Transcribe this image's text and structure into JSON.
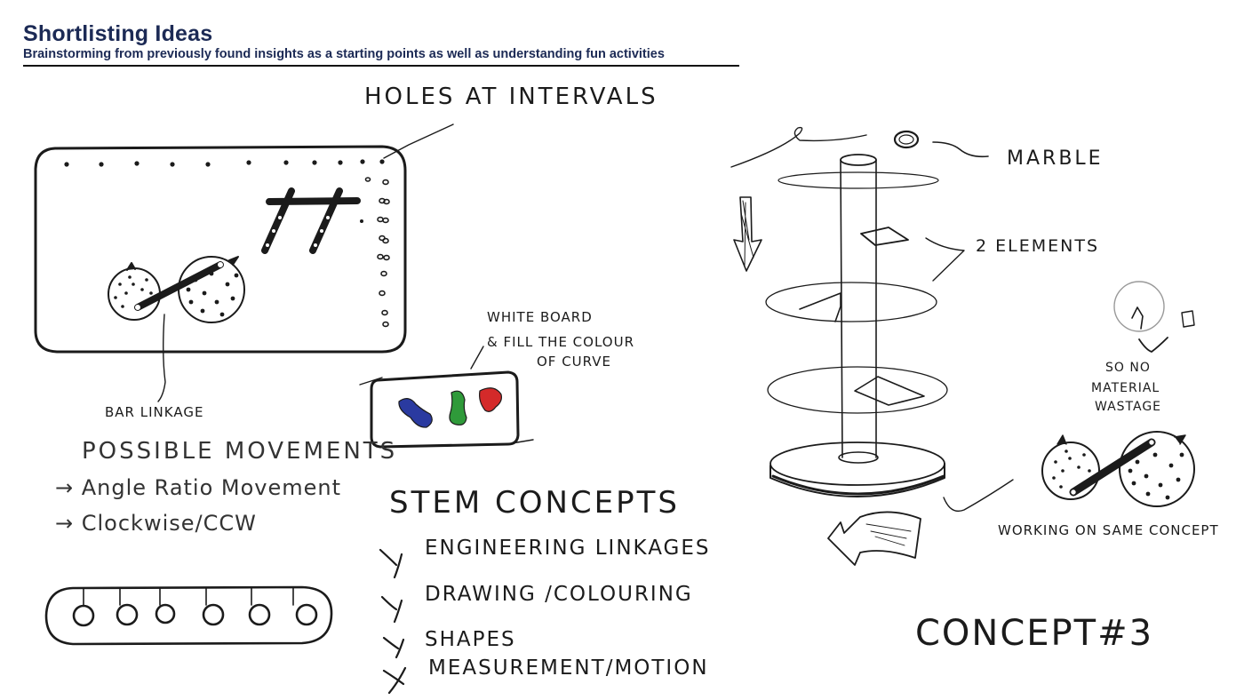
{
  "header": {
    "title": "Shortlisting Ideas",
    "subtitle": "Brainstorming from previously found insights as a starting points as well as understanding fun activities"
  },
  "sketch1": {
    "holes_label": "Holes at intervals",
    "bar_linkage_label": "Bar linkage",
    "possible_movements": {
      "heading": "Possible movements",
      "items": [
        "→ Angle Ratio Movement",
        "→ Clockwise/CCW"
      ]
    }
  },
  "whiteboard": {
    "label_line1": "White board",
    "label_line2": "& fill the colour",
    "label_line3": "of curve"
  },
  "stem": {
    "heading": "Stem concepts",
    "items": [
      "Engineering linkages",
      "Drawing /colouring",
      "Shapes",
      "Measurement/motion"
    ]
  },
  "tower": {
    "marble_label": "Marble",
    "elements_label": "2 elements",
    "wastage_line1": "So no",
    "wastage_line2": "material",
    "wastage_line3": "wastage",
    "working_label": "Working on same concept",
    "concept_label": "Concept#3"
  },
  "colors": {
    "title": "#1c2a55",
    "ink": "#1b1b1b",
    "blob_blue": "#2a3aa0",
    "blob_green": "#2f9a3a",
    "blob_red": "#d42a2a"
  }
}
